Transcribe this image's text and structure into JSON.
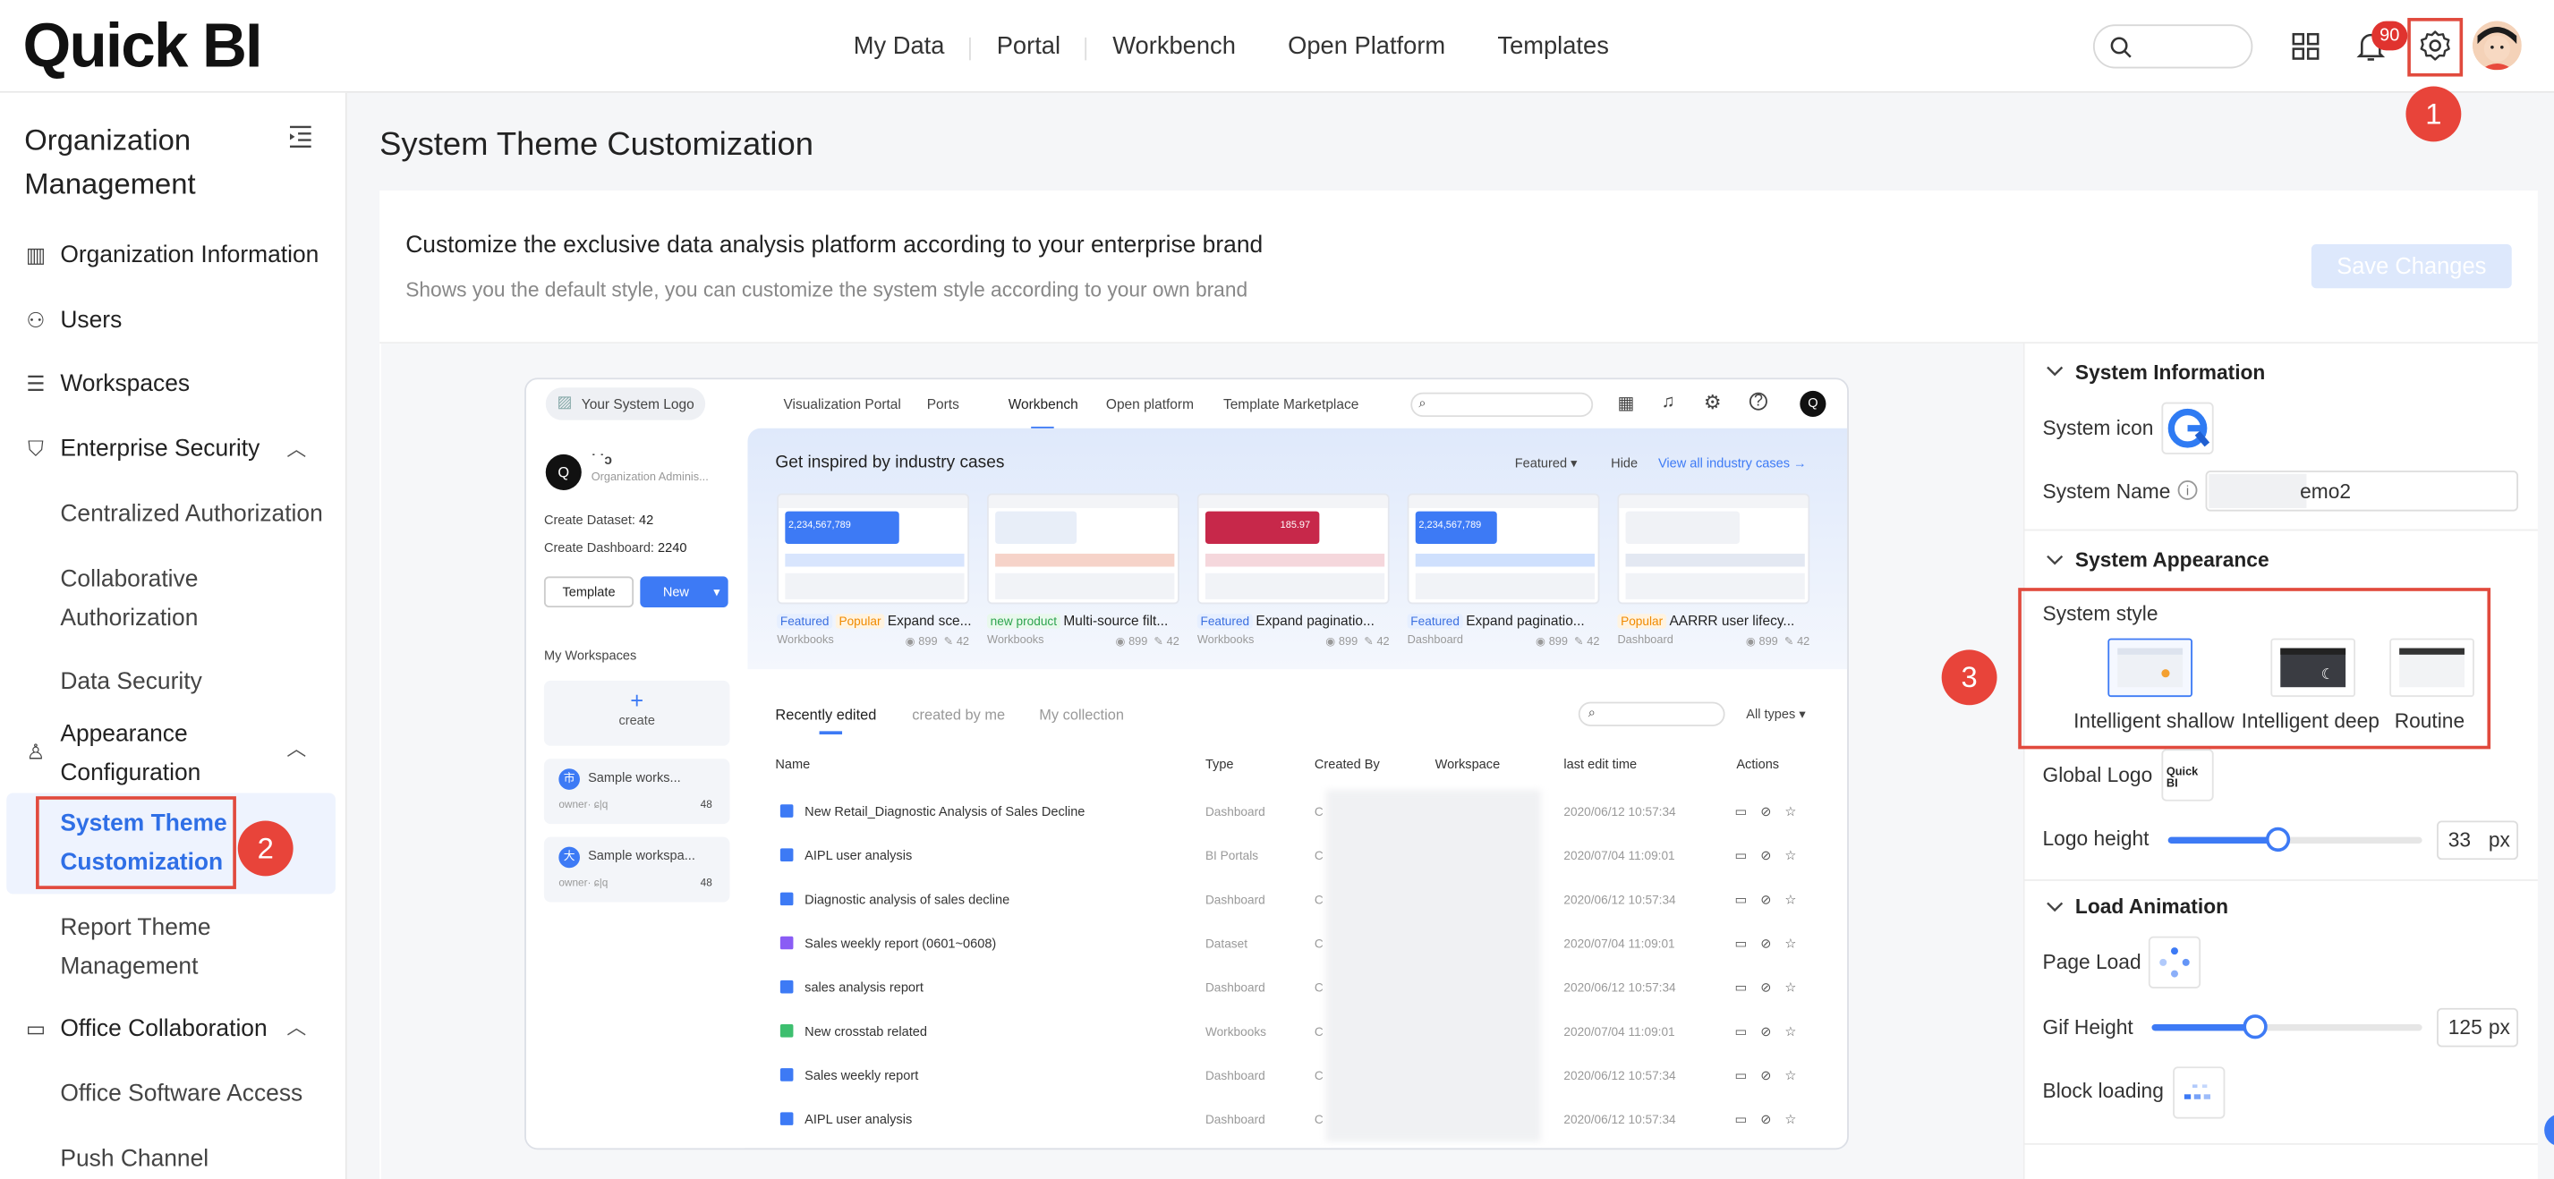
{
  "header": {
    "logo": "Quick BI",
    "nav": [
      "My Data",
      "Portal",
      "Workbench",
      "Open Platform",
      "Templates"
    ],
    "notification_count": "90",
    "icons": [
      "search-icon",
      "grid-icon",
      "bell-icon",
      "gear-icon",
      "avatar"
    ]
  },
  "sidebar": {
    "title": "Organization Management",
    "items": {
      "org_info": "Organization Information",
      "users": "Users",
      "workspaces": "Workspaces",
      "enterprise_security": "Enterprise Security",
      "centralized_auth": "Centralized Authorization",
      "collab_auth": "Collaborative Authorization",
      "data_security": "Data Security",
      "appearance_config": "Appearance Configuration",
      "system_theme": "System Theme Customization",
      "report_theme": "Report Theme Management",
      "office_collab": "Office Collaboration",
      "office_access": "Office Software Access",
      "push_channel": "Push Channel"
    }
  },
  "callouts": [
    "1",
    "2",
    "3"
  ],
  "main": {
    "page_title": "System Theme Customization",
    "headline": "Customize the exclusive data analysis platform according to your enterprise brand",
    "subline": "Shows you the default style, you can customize the system style according to your own brand",
    "save_label": "Save Changes"
  },
  "mockup": {
    "logo_label": "Your System Logo",
    "nav": [
      "Visualization Portal",
      "Ports",
      "Workbench",
      "Open platform",
      "Template Marketplace"
    ],
    "user_initial": "Q",
    "user_name": "˙ ˙ɔ",
    "user_role": "Organization Adminis...",
    "create_dataset": "Create Dataset:",
    "create_dataset_n": "42",
    "create_dashboard": "Create Dashboard:",
    "create_dashboard_n": "2240",
    "template_btn": "Template",
    "new_btn": "New",
    "my_workspaces": "My Workspaces",
    "create": "create",
    "workspaces": [
      {
        "icon": "市",
        "name": "Sample works...",
        "owner": "owner· ɕ|q",
        "count": "48"
      },
      {
        "icon": "大",
        "name": "Sample workspa...",
        "owner": "owner· ɕ|q",
        "count": "48"
      }
    ],
    "inspired": "Get inspired by industry cases",
    "featured": "Featured",
    "hide": "Hide",
    "view_all": "View all industry cases",
    "thumb_value": "2,234,567,789",
    "thumb_value2": "185.97",
    "cases": [
      {
        "tags": [
          "Featured",
          "Popular"
        ],
        "title": "Expand sce...",
        "type": "Workbooks",
        "views": "899",
        "likes": "42"
      },
      {
        "tags": [
          "new product"
        ],
        "title": "Multi-source filt...",
        "type": "Workbooks",
        "views": "899",
        "likes": "42"
      },
      {
        "tags": [
          "Featured"
        ],
        "title": "Expand paginatio...",
        "type": "Workbooks",
        "views": "899",
        "likes": "42"
      },
      {
        "tags": [
          "Featured"
        ],
        "title": "Expand paginatio...",
        "type": "Dashboard",
        "views": "899",
        "likes": "42"
      },
      {
        "tags": [
          "Popular"
        ],
        "title": "AARRR user lifecy...",
        "type": "Dashboard",
        "views": "899",
        "likes": "42"
      }
    ],
    "tabs": [
      "Recently edited",
      "created by me",
      "My collection"
    ],
    "all_types": "All types",
    "columns": [
      "Name",
      "Type",
      "Created By",
      "Workspace",
      "last edit time",
      "Actions"
    ],
    "rows": [
      {
        "name": "New Retail_Diagnostic Analysis of Sales Decline",
        "type": "Dashboard",
        "by": "C",
        "time": "2020/06/12 10:57:34"
      },
      {
        "name": "AIPL user analysis",
        "type": "BI Portals",
        "by": "C",
        "time": "2020/07/04 11:09:01"
      },
      {
        "name": "Diagnostic analysis of sales decline",
        "type": "Dashboard",
        "by": "C",
        "time": "2020/06/12 10:57:34"
      },
      {
        "name": "Sales weekly report (0601~0608)",
        "type": "Dataset",
        "by": "C",
        "time": "2020/07/04 11:09:01"
      },
      {
        "name": "sales analysis report",
        "type": "Dashboard",
        "by": "C",
        "time": "2020/06/12 10:57:34"
      },
      {
        "name": "New crosstab related",
        "type": "Workbooks",
        "by": "C",
        "time": "2020/07/04 11:09:01"
      },
      {
        "name": "Sales weekly report",
        "type": "Dashboard",
        "by": "C",
        "time": "2020/06/12 10:57:34"
      },
      {
        "name": "AIPL user analysis",
        "type": "Dashboard",
        "by": "C",
        "time": "2020/06/12 10:57:34"
      }
    ]
  },
  "panel": {
    "system_info": "System Information",
    "system_icon": "System icon",
    "system_name": "System Name",
    "system_name_value": "emo2",
    "system_appearance": "System Appearance",
    "system_style": "System style",
    "styles": [
      "Intelligent shallow",
      "Intelligent deep",
      "Routine"
    ],
    "selected_style": "Intelligent shallow",
    "global_logo": "Global Logo",
    "global_logo_text": "Quick BI",
    "logo_height": "Logo height",
    "logo_height_value": "33",
    "logo_height_fraction": 0.43,
    "unit": "px",
    "load_animation": "Load Animation",
    "page_load": "Page Load",
    "gif_height": "Gif Height",
    "gif_height_value": "125",
    "gif_height_fraction": 0.38,
    "block_loading": "Block loading",
    "accent": "#3d7af5"
  }
}
